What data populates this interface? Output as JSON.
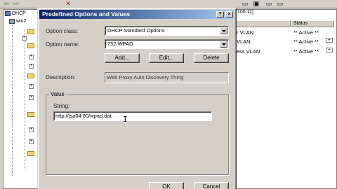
{
  "background": {
    "tree_root": "DHCP",
    "tree_server": "win2",
    "tab_peek": "100.11]",
    "list_header_status": "Status",
    "rows": [
      {
        "name": "r VLAN",
        "status": "** Active **"
      },
      {
        "name": "VLAN",
        "status": "** Active **"
      },
      {
        "name": "ess VLAN",
        "status": "** Active **"
      }
    ]
  },
  "dialog": {
    "title": "Predefined Options and Values",
    "help_btn": "?",
    "close_btn": "×",
    "option_class_label": "Option class:",
    "option_class_value": "DHCP Standard Options",
    "option_name_label": "Option name:",
    "option_name_value": "252 WPAD",
    "add_label": "Add...",
    "edit_label": "Edit...",
    "delete_label": "Delete",
    "description_label": "Description:",
    "description_value": "Web Proxy Auto Discovery Thing",
    "value_group_label": "Value",
    "string_label": "String:",
    "string_value": "http://isa04:80/wpad.dat",
    "ok_label": "OK",
    "cancel_label": "Cancel"
  }
}
